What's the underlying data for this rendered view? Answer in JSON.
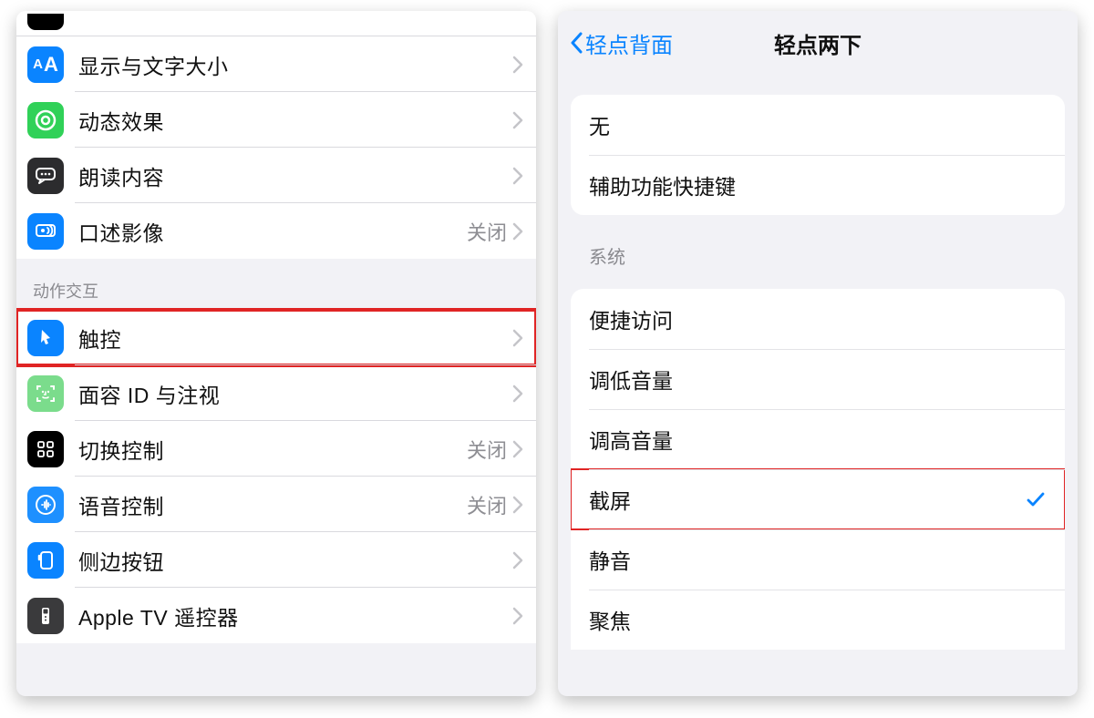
{
  "left": {
    "group1": {
      "items": [
        {
          "label": "显示与文字大小",
          "value": "",
          "icon": "text-size-icon",
          "bg": "bg-blue"
        },
        {
          "label": "动态效果",
          "value": "",
          "icon": "motion-icon",
          "bg": "bg-green"
        },
        {
          "label": "朗读内容",
          "value": "",
          "icon": "speech-bubble-icon",
          "bg": "bg-dkgray"
        },
        {
          "label": "口述影像",
          "value": "关闭",
          "icon": "audio-desc-icon",
          "bg": "bg-blue"
        }
      ]
    },
    "group2": {
      "header": "动作交互",
      "items": [
        {
          "label": "触控",
          "value": "",
          "icon": "touch-icon",
          "bg": "bg-blue",
          "highlight": true
        },
        {
          "label": "面容 ID 与注视",
          "value": "",
          "icon": "faceid-icon",
          "bg": "bg-lgreen"
        },
        {
          "label": "切换控制",
          "value": "关闭",
          "icon": "switch-control-icon",
          "bg": "bg-black"
        },
        {
          "label": "语音控制",
          "value": "关闭",
          "icon": "voice-control-icon",
          "bg": "bg-lblue"
        },
        {
          "label": "侧边按钮",
          "value": "",
          "icon": "side-button-icon",
          "bg": "bg-blue"
        },
        {
          "label": "Apple TV 遥控器",
          "value": "",
          "icon": "apple-tv-icon",
          "bg": "bg-gray"
        }
      ]
    }
  },
  "right": {
    "back_label": "轻点背面",
    "title": "轻点两下",
    "group1": {
      "items": [
        {
          "label": "无",
          "selected": false
        },
        {
          "label": "辅助功能快捷键",
          "selected": false
        }
      ]
    },
    "group2": {
      "header": "系统",
      "items": [
        {
          "label": "便捷访问",
          "selected": false
        },
        {
          "label": "调低音量",
          "selected": false
        },
        {
          "label": "调高音量",
          "selected": false
        },
        {
          "label": "截屏",
          "selected": true,
          "highlight": true
        },
        {
          "label": "静音",
          "selected": false
        },
        {
          "label": "聚焦",
          "selected": false
        }
      ]
    }
  }
}
